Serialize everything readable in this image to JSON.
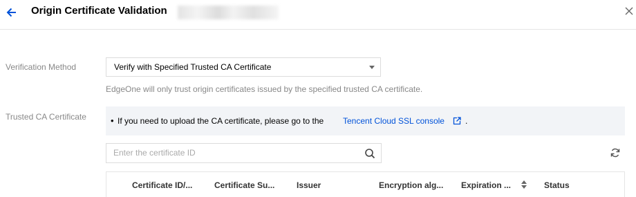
{
  "header": {
    "title": "Origin Certificate Validation",
    "back_icon": "arrow-left-icon",
    "close_icon": "close-icon",
    "accent_color": "#0052d9"
  },
  "form": {
    "verification_method_label": "Verification Method",
    "verification_method_value": "Verify with Specified Trusted CA Certificate",
    "verification_helper": "EdgeOne will only trust origin certificates issued by the specified trusted CA certificate.",
    "trusted_ca_label": "Trusted CA Certificate",
    "notice_text": "If you need to upload the CA certificate, please go to the",
    "notice_link": "Tencent Cloud SSL console",
    "notice_end": "."
  },
  "search": {
    "placeholder": "Enter the certificate ID",
    "icon": "search-icon"
  },
  "table": {
    "columns": [
      "Certificate ID/...",
      "Certificate Su...",
      "Issuer",
      "Encryption alg...",
      "Expiration ...",
      "Status"
    ]
  }
}
